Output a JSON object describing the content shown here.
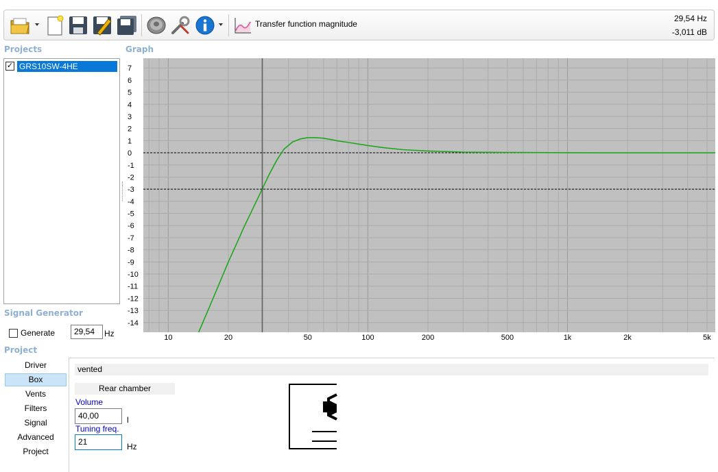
{
  "toolbar": {
    "buttons": [
      {
        "name": "open-folder-icon"
      },
      {
        "name": "new-document-icon"
      },
      {
        "name": "save-icon"
      },
      {
        "name": "save-as-icon"
      },
      {
        "name": "save-all-icon"
      },
      {
        "name": "speaker-icon"
      },
      {
        "name": "tools-icon"
      },
      {
        "name": "info-icon"
      }
    ],
    "graph_selector_label": "Transfer function magnitude",
    "readout_frequency": "29,54 Hz",
    "readout_level": "-3,011 dB"
  },
  "projects": {
    "title": "Projects",
    "items": [
      {
        "label": "GRS10SW-4HE",
        "checked": true
      }
    ]
  },
  "graph": {
    "title": "Graph"
  },
  "signal_generator": {
    "title": "Signal Generator",
    "generate_label": "Generate",
    "generate_checked": false,
    "frequency": "29,54",
    "unit": "Hz"
  },
  "project_section": {
    "title": "Project",
    "nav": [
      "Driver",
      "Box",
      "Vents",
      "Filters",
      "Signal",
      "Advanced",
      "Project"
    ],
    "active_nav": "Box"
  },
  "box": {
    "type": "vented",
    "chamber_header": "Rear chamber",
    "volume_label": "Volume",
    "volume_value": "40,00",
    "volume_unit": "l",
    "tuning_label": "Tuning freq.",
    "tuning_value": "21",
    "tuning_unit": "Hz"
  },
  "chart_data": {
    "type": "line",
    "title": "",
    "xlabel": "",
    "ylabel": "",
    "x_scale": "log",
    "xlim": [
      7.5,
      5500
    ],
    "ylim": [
      -14.8,
      7.8
    ],
    "x_ticks": [
      {
        "value": 10,
        "label": "10"
      },
      {
        "value": 20,
        "label": "20"
      },
      {
        "value": 50,
        "label": "50"
      },
      {
        "value": 100,
        "label": "100"
      },
      {
        "value": 200,
        "label": "200"
      },
      {
        "value": 500,
        "label": "500"
      },
      {
        "value": 1000,
        "label": "1k"
      },
      {
        "value": 2000,
        "label": "2k"
      },
      {
        "value": 5000,
        "label": "5k"
      }
    ],
    "y_ticks": [
      7,
      6,
      5,
      4,
      3,
      2,
      1,
      0,
      -1,
      -2,
      -3,
      -4,
      -5,
      -6,
      -7,
      -8,
      -9,
      -10,
      -11,
      -12,
      -13,
      -14
    ],
    "grid": true,
    "reference_lines_y": [
      0,
      -3
    ],
    "cursor_x": 29.54,
    "series": [
      {
        "color": "#1fa61f",
        "x": [
          14.2,
          16,
          18,
          20,
          22,
          24,
          26,
          28,
          29.54,
          32,
          35,
          38,
          42,
          46,
          50,
          55,
          60,
          65,
          70,
          80,
          90,
          100,
          120,
          150,
          200,
          300,
          500,
          1000,
          2000,
          5500
        ],
        "y": [
          -14.8,
          -12.8,
          -10.8,
          -9.0,
          -7.5,
          -6.1,
          -4.9,
          -3.8,
          -3.0,
          -1.8,
          -0.6,
          0.3,
          0.9,
          1.15,
          1.25,
          1.25,
          1.2,
          1.1,
          1.0,
          0.85,
          0.72,
          0.6,
          0.42,
          0.26,
          0.15,
          0.06,
          0.03,
          0.01,
          0.0,
          0.0
        ]
      }
    ]
  }
}
